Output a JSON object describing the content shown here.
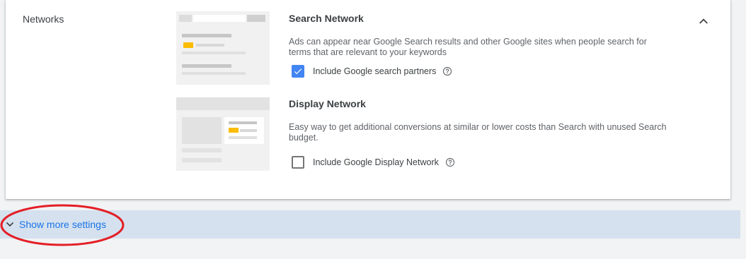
{
  "networks": {
    "section_label": "Networks",
    "search": {
      "title": "Search Network",
      "description": "Ads can appear near Google Search results and other Google sites when people search for terms that are relevant to your keywords",
      "checkbox_label": "Include Google search partners",
      "checked": true
    },
    "display": {
      "title": "Display Network",
      "description": "Easy way to get additional conversions at similar or lower costs than Search with unused Search budget.",
      "checkbox_label": "Include Google Display Network",
      "checked": false
    }
  },
  "footer": {
    "show_more_label": "Show more settings"
  },
  "icons": {
    "collapse": "chevron-up-icon",
    "help": "help-outline-icon",
    "expand": "chevron-down-icon",
    "checkmark": "checkmark-icon"
  },
  "colors": {
    "accent": "#4285f4",
    "link": "#1a73e8",
    "bar_background": "#d5e1ee",
    "annotation_red": "#e41e26"
  }
}
